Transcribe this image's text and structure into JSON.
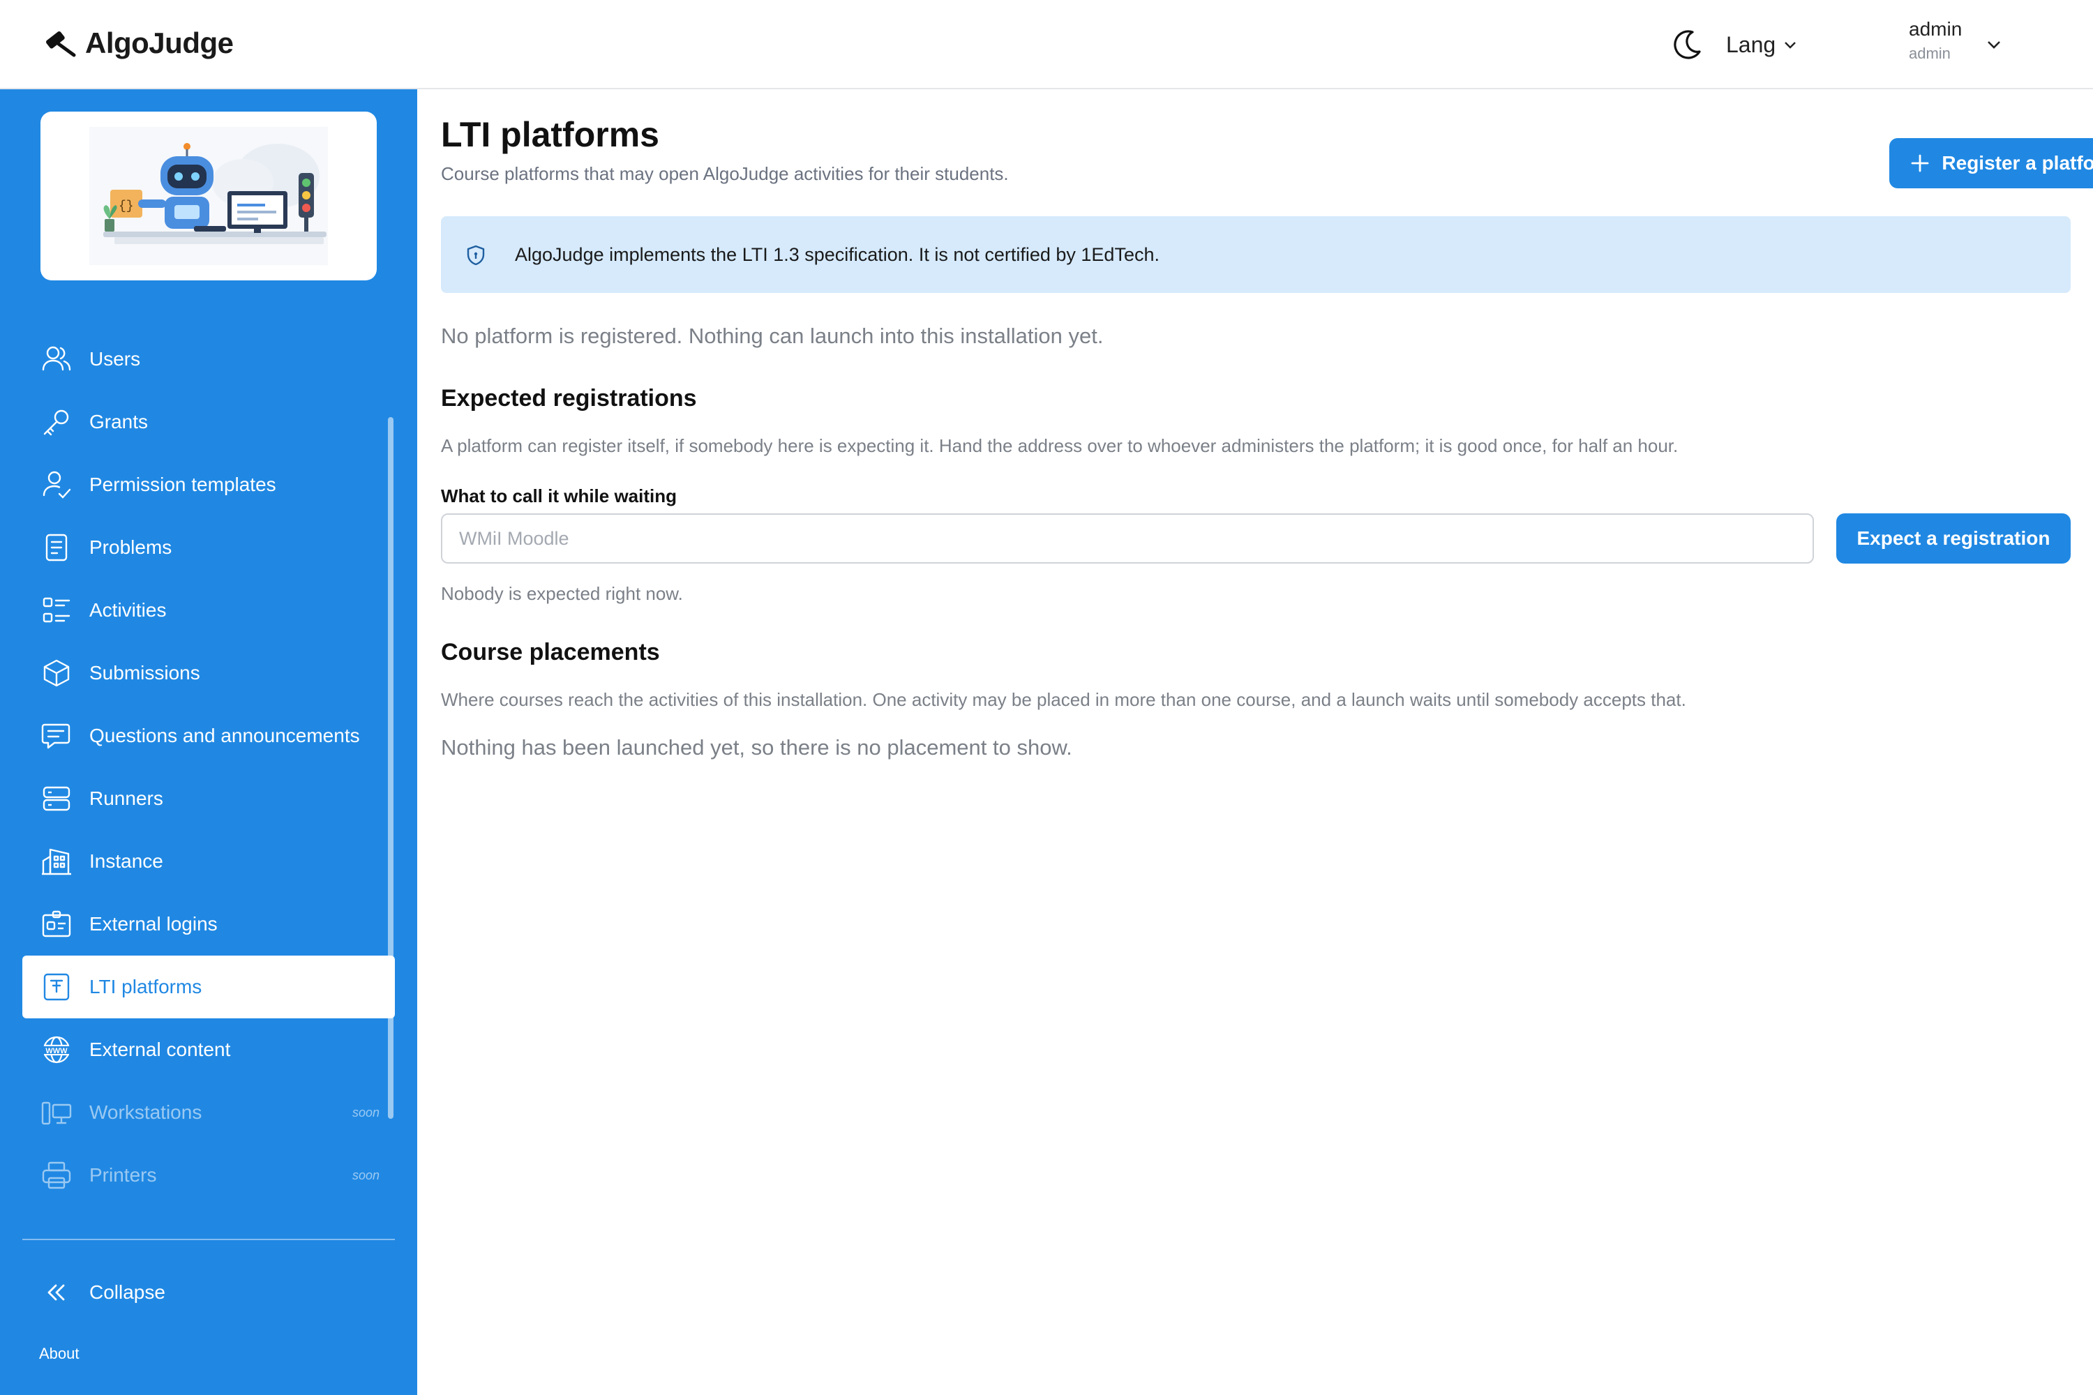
{
  "header": {
    "app_name": "AlgoJudge",
    "lang_label": "Lang",
    "user_name": "admin",
    "user_role": "admin"
  },
  "sidebar": {
    "items": [
      {
        "label": "Users",
        "icon": "users-icon"
      },
      {
        "label": "Grants",
        "icon": "key-icon"
      },
      {
        "label": "Permission templates",
        "icon": "user-check-icon"
      },
      {
        "label": "Problems",
        "icon": "document-icon"
      },
      {
        "label": "Activities",
        "icon": "list-icon"
      },
      {
        "label": "Submissions",
        "icon": "cube-icon"
      },
      {
        "label": "Questions and announcements",
        "icon": "chat-icon"
      },
      {
        "label": "Runners",
        "icon": "server-icon"
      },
      {
        "label": "Instance",
        "icon": "building-icon"
      },
      {
        "label": "External logins",
        "icon": "id-card-icon"
      },
      {
        "label": "LTI platforms",
        "icon": "lti-icon",
        "active": true
      },
      {
        "label": "External content",
        "icon": "www-icon"
      },
      {
        "label": "Workstations",
        "icon": "workstation-icon",
        "disabled": true,
        "badge": "soon"
      },
      {
        "label": "Printers",
        "icon": "printer-icon",
        "disabled": true,
        "badge": "soon"
      }
    ],
    "collapse_label": "Collapse",
    "about_label": "About"
  },
  "main": {
    "title": "LTI platforms",
    "subtitle": "Course platforms that may open AlgoJudge activities for their students.",
    "register_button": "Register a platform",
    "info_banner": "AlgoJudge implements the LTI 1.3 specification. It is not certified by 1EdTech.",
    "empty_platforms": "No platform is registered. Nothing can launch into this installation yet.",
    "expected": {
      "heading": "Expected registrations",
      "description": "A platform can register itself, if somebody here is expecting it. Hand the address over to whoever administers the platform; it is good once, for half an hour.",
      "field_label": "What to call it while waiting",
      "field_placeholder": "WMiI Moodle",
      "field_value": "",
      "button": "Expect a registration",
      "empty": "Nobody is expected right now."
    },
    "placements": {
      "heading": "Course placements",
      "description": "Where courses reach the activities of this installation. One activity may be placed in more than one course, and a launch waits until somebody accepts that.",
      "empty": "Nothing has been launched yet, so there is no placement to show."
    }
  },
  "colors": {
    "accent": "#2088e3",
    "info_banner_bg": "#d6eafc",
    "muted_text": "#7b8088"
  }
}
